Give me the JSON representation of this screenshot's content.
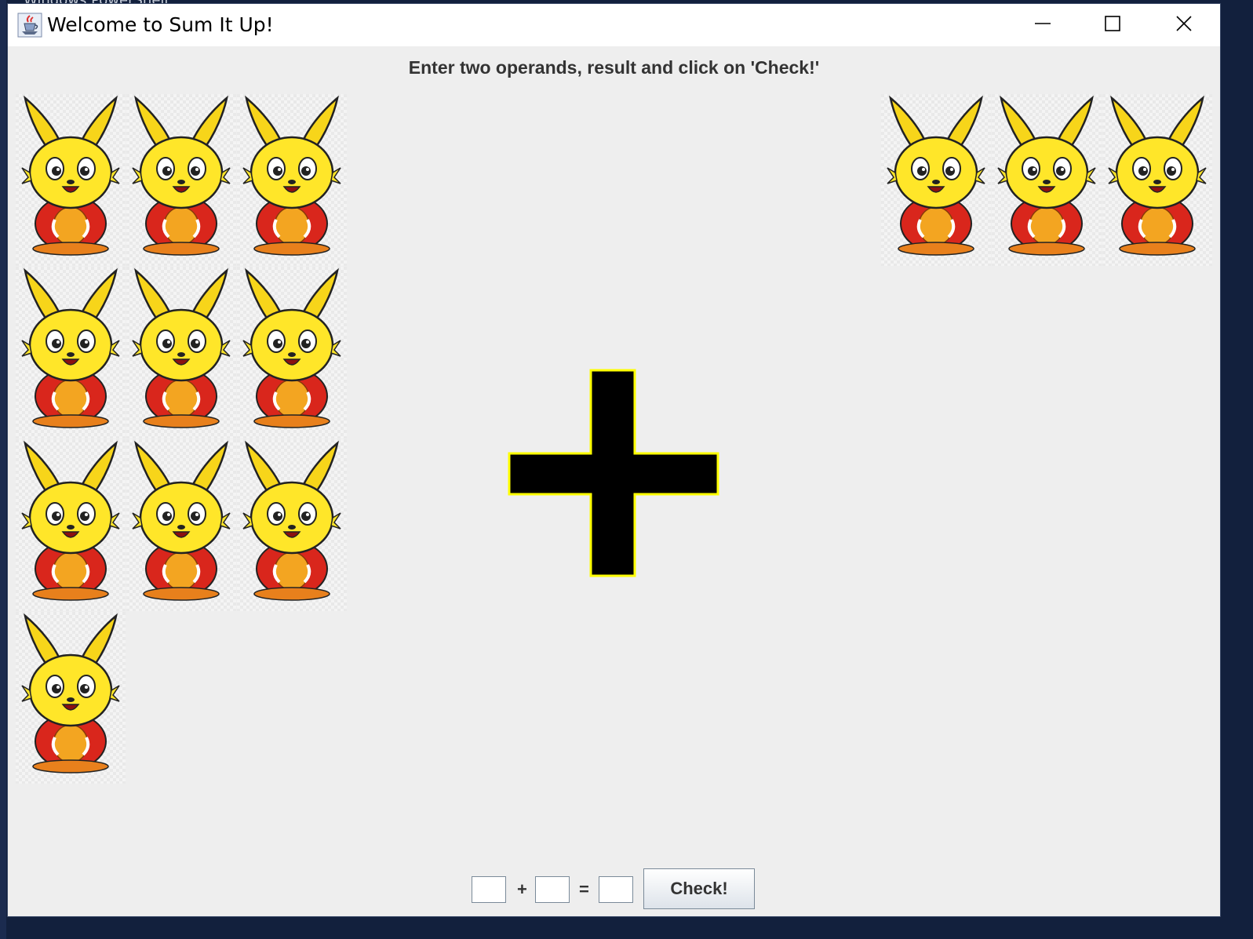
{
  "window": {
    "title": "Welcome to Sum It Up!",
    "icon": "java-coffee-cup-icon",
    "controls": [
      "minimize-icon",
      "maximize-icon",
      "close-icon"
    ]
  },
  "background_terminal": {
    "title": "Windows PowerShell"
  },
  "instructions": "Enter two operands, result and click on 'Check!'",
  "left_operand_bunnies": 10,
  "right_operand_bunnies": 3,
  "operator_symbol": "plus-icon",
  "form": {
    "operand1_value": "",
    "plus_label": "+",
    "operand2_value": "",
    "equals_label": "=",
    "result_value": "",
    "check_label": "Check!"
  },
  "colors": {
    "window_bg": "#eeeeee",
    "plus_fill": "#000000",
    "plus_outline": "#ffff00"
  }
}
